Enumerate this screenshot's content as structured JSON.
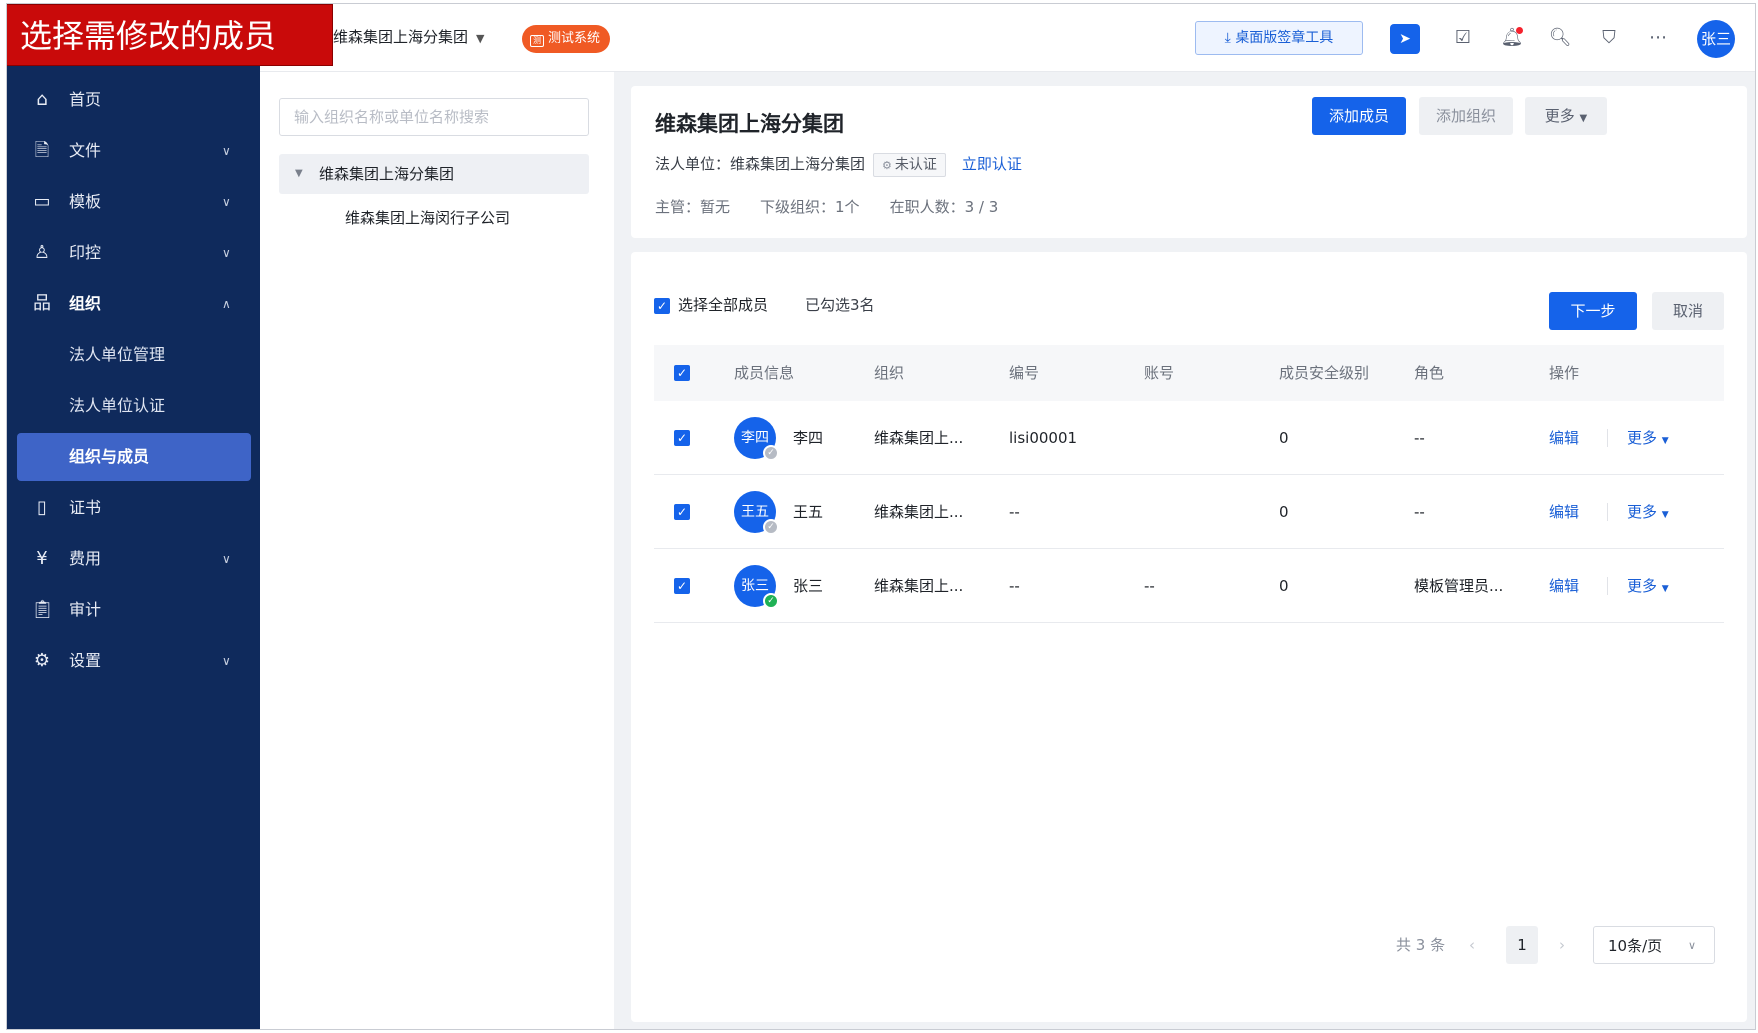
{
  "caption": "选择需修改的成员",
  "header": {
    "org_name": "维森集团上海分集团",
    "env_badge": "测试系统",
    "env_badge_icon": "测",
    "desktop_tool": "桌面版签章工具",
    "user_avatar": "张三"
  },
  "sidebar": {
    "items": [
      {
        "label": "首页",
        "icon": "home-icon"
      },
      {
        "label": "文件",
        "icon": "file-icon"
      },
      {
        "label": "模板",
        "icon": "template-icon"
      },
      {
        "label": "印控",
        "icon": "seal-icon"
      },
      {
        "label": "组织",
        "icon": "org-icon"
      },
      {
        "label": "证书",
        "icon": "certificate-icon"
      },
      {
        "label": "费用",
        "icon": "fee-icon"
      },
      {
        "label": "审计",
        "icon": "audit-icon"
      },
      {
        "label": "设置",
        "icon": "settings-icon"
      }
    ],
    "org_sub": [
      "法人单位管理",
      "法人单位认证",
      "组织与成员"
    ]
  },
  "tree": {
    "search_placeholder": "输入组织名称或单位名称搜索",
    "root": "维森集团上海分集团",
    "child": "维森集团上海闵行子公司"
  },
  "org_info": {
    "title": "维森集团上海分集团",
    "legal_unit_label": "法人单位：",
    "legal_unit_value": "维森集团上海分集团",
    "cert_status": "未认证",
    "cert_link": "立即认证",
    "manager": "主管：暂无",
    "sub_orgs": "下级组织：1个",
    "headcount": "在职人数：3 / 3",
    "btn_add_member": "添加成员",
    "btn_add_org": "添加组织",
    "btn_more": "更多"
  },
  "members": {
    "select_all": "选择全部成员",
    "selected_count": "已勾选3名",
    "btn_next": "下一步",
    "btn_cancel": "取消",
    "columns": [
      "成员信息",
      "组织",
      "编号",
      "账号",
      "成员安全级别",
      "角色",
      "操作"
    ],
    "rows": [
      {
        "avatar": "李四",
        "name": "李四",
        "org": "维森集团上...",
        "code": "lisi00001",
        "account": "",
        "level": "0",
        "role": "--",
        "edit": "编辑",
        "more": "更多",
        "verified": false
      },
      {
        "avatar": "王五",
        "name": "王五",
        "org": "维森集团上...",
        "code": "--",
        "account": "",
        "level": "0",
        "role": "--",
        "edit": "编辑",
        "more": "更多",
        "verified": false
      },
      {
        "avatar": "张三",
        "name": "张三",
        "org": "维森集团上...",
        "code": "--",
        "account": "--",
        "level": "0",
        "role": "模板管理员...",
        "edit": "编辑",
        "more": "更多",
        "verified": true
      }
    ]
  },
  "pagination": {
    "total": "共 3 条",
    "current_page": "1",
    "page_size": "10条/页"
  }
}
